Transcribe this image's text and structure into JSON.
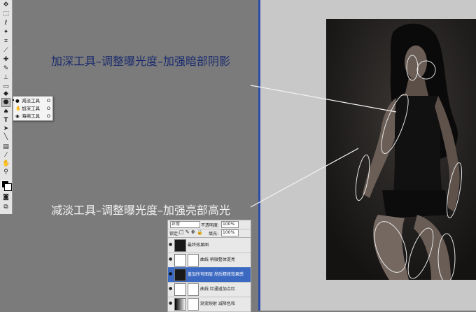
{
  "toolbox": {
    "tools": [
      "move-icon",
      "marquee-icon",
      "lasso-icon",
      "magic-wand-icon",
      "crop-icon",
      "slice-icon",
      "healing-brush-icon",
      "brush-icon",
      "clone-stamp-icon",
      "history-brush-icon",
      "eraser-icon",
      "gradient-icon",
      "blur-icon",
      "dodge-icon",
      "pen-icon",
      "type-icon",
      "path-selection-icon",
      "shape-icon",
      "notes-icon",
      "eyedropper-icon",
      "hand-icon",
      "zoom-icon"
    ]
  },
  "flyout": {
    "items": [
      {
        "label": "减淡工具",
        "key": "O",
        "icon": "dodge-icon"
      },
      {
        "label": "加深工具",
        "key": "O",
        "icon": "burn-icon"
      },
      {
        "label": "海绵工具",
        "key": "O",
        "icon": "sponge-icon"
      }
    ]
  },
  "annotations": {
    "burn": "加深工具–调整曝光度–加强暗部阴影",
    "dodge": "减淡工具–调整曝光度–加强亮部高光"
  },
  "layers_panel": {
    "blend_mode": "正常",
    "opacity_label": "不透明度:",
    "opacity_value": "100%",
    "lock_label": "锁定:",
    "fill_label": "填充:",
    "fill_value": "100%",
    "layers": [
      {
        "name": "最终效果图",
        "type": "image",
        "active": false
      },
      {
        "name": "曲线 稍微整体提亮",
        "type": "adjustment",
        "active": false
      },
      {
        "name": "盖加所有图层 然后精修效果感",
        "type": "image",
        "active": true
      },
      {
        "name": "曲线 红通道加点红",
        "type": "adjustment",
        "active": false
      },
      {
        "name": "渐变映射 减降色和",
        "type": "adjustment",
        "active": false
      }
    ]
  },
  "colors": {
    "workspace_dark": "#7b7b7b",
    "workspace_light": "#c8c8c8",
    "divider": "#2c4da8",
    "annotation_dark": "#1b2c6e",
    "annotation_light": "#f2f2f2",
    "layer_selected": "#3b69c2"
  }
}
